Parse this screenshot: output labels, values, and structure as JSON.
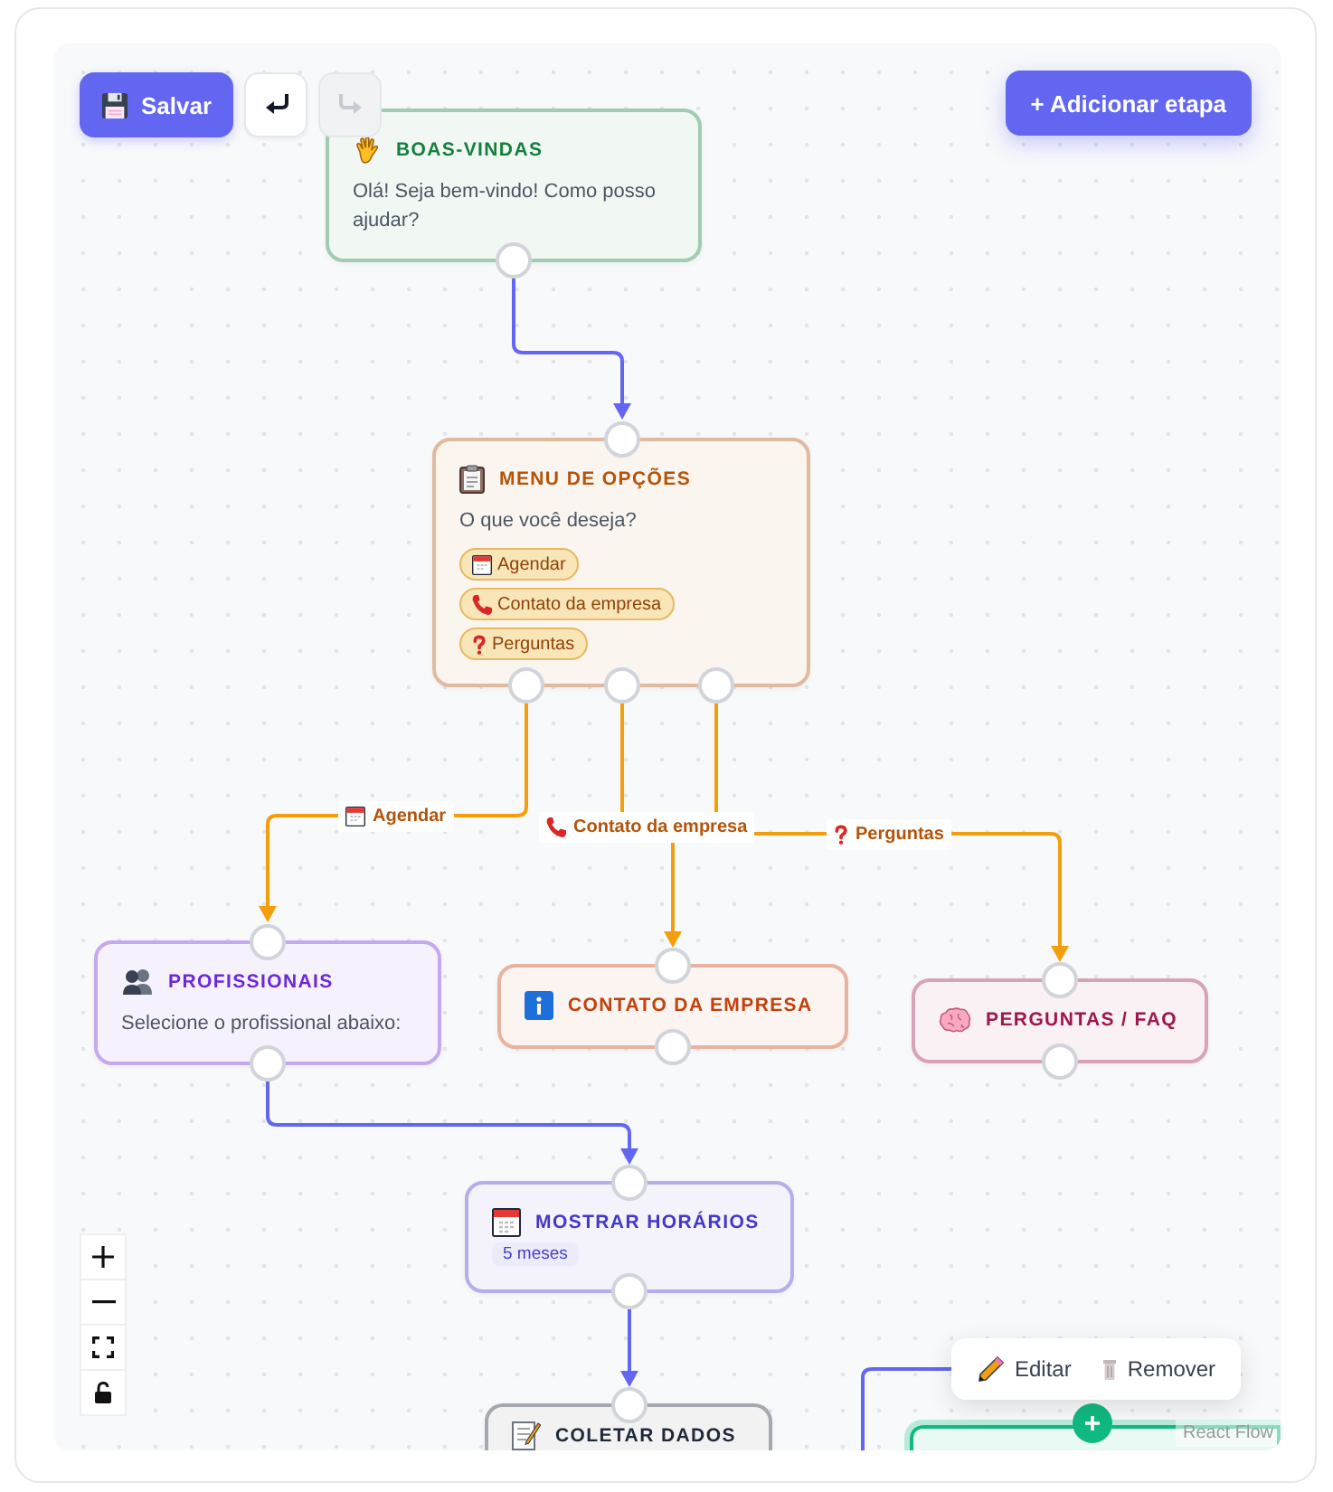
{
  "toolbar": {
    "save_button": {
      "label": "Salvar"
    },
    "undo_button": {
      "disabled": false
    },
    "redo_button": {
      "disabled": true
    },
    "add_step_button": {
      "label": "+ Adicionar etapa"
    }
  },
  "nodes": [
    {
      "kind": "greeting",
      "title": "BOAS-VINDAS",
      "color": "#15803d",
      "selected": false,
      "text": "Olá! Seja bem-vindo! Como posso ajudar?"
    },
    {
      "kind": "menu",
      "title": "MENU DE OPÇÕES",
      "color": "#b45309",
      "selected": false,
      "text": "O que você deseja?",
      "options": [
        "Agendar",
        "Contato da empresa",
        "Perguntas"
      ]
    },
    {
      "kind": "list",
      "title": "PROFISSIONAIS",
      "color": "#6d28d9",
      "selected": false,
      "text": "Selecione o profissional abaixo:"
    },
    {
      "kind": "info",
      "title": "CONTATO DA EMPRESA",
      "color": "#c2410c",
      "selected": false
    },
    {
      "kind": "faq",
      "title": "PERGUNTAS / FAQ",
      "color": "#9d174d",
      "selected": false
    },
    {
      "kind": "schedule",
      "title": "MOSTRAR HORÁRIOS",
      "color": "#4338ca",
      "selected": false,
      "badge": "5 meses"
    },
    {
      "kind": "form",
      "title": "COLETAR DADOS",
      "color": "#1f2937",
      "selected": false
    },
    {
      "kind": "confirm",
      "color": "#10b981",
      "selected": true
    }
  ],
  "edge_labels": [
    "Agendar",
    "Contato da empresa",
    "Perguntas"
  ],
  "context_menu": {
    "items": [
      "Editar",
      "Remover"
    ]
  },
  "attribution": "React Flow"
}
